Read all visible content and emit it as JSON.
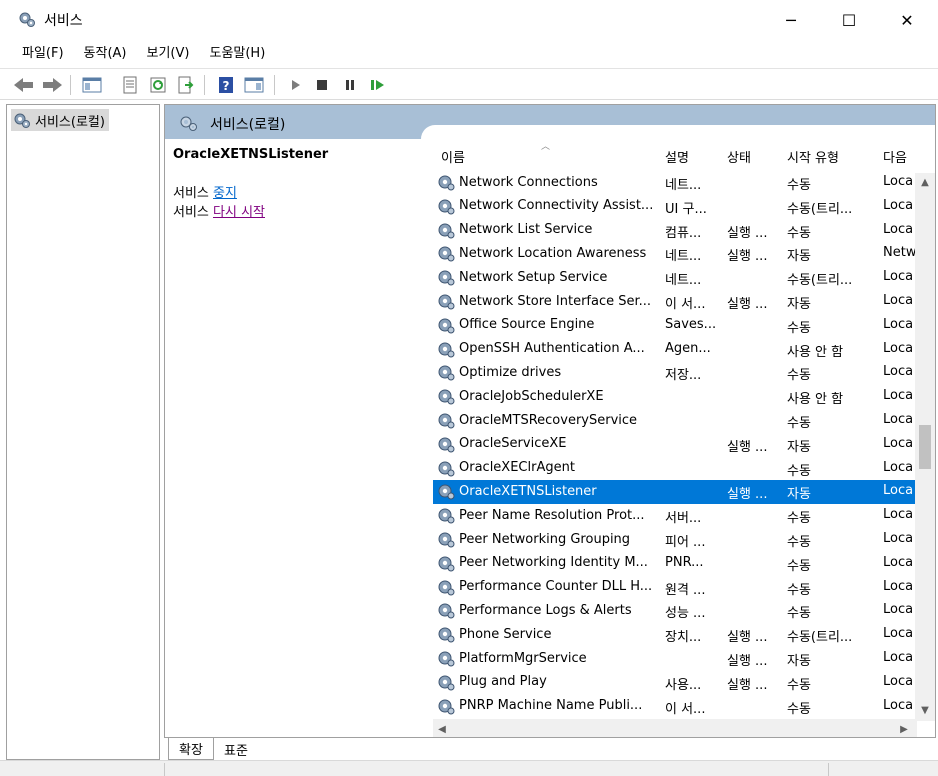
{
  "window": {
    "title": "서비스",
    "minimize_glyph": "─",
    "maximize_glyph": "☐",
    "close_glyph": "✕"
  },
  "menu": [
    "파일(F)",
    "동작(A)",
    "보기(V)",
    "도움말(H)"
  ],
  "toolbar_icons": [
    "back-arrow-icon",
    "forward-arrow-icon",
    "show-hide-console-tree-icon",
    "properties-icon",
    "refresh-icon",
    "export-list-icon",
    "help-icon",
    "show-action-pane-icon",
    "start-service-icon",
    "stop-service-icon",
    "pause-service-icon",
    "restart-service-icon"
  ],
  "tree": {
    "root_label": "서비스(로컬)"
  },
  "pane": {
    "header_title": "서비스(로컬)",
    "selected_service": "OracleXETNSListener",
    "action1_prefix": "서비스 ",
    "action1_link": "중지",
    "action2_prefix": "서비스 ",
    "action2_link": "다시 시작"
  },
  "columns": {
    "name": "이름",
    "desc": "설명",
    "status": "상태",
    "startup": "시작 유형",
    "logon": "다음"
  },
  "rows": [
    {
      "name": "Network Connections",
      "desc": "네트...",
      "status": "",
      "startup": "수동",
      "logon": "Loca"
    },
    {
      "name": "Network Connectivity Assist...",
      "desc": "UI 구...",
      "status": "",
      "startup": "수동(트리...",
      "logon": "Loca"
    },
    {
      "name": "Network List Service",
      "desc": "컴퓨...",
      "status": "실행 ...",
      "startup": "수동",
      "logon": "Loca"
    },
    {
      "name": "Network Location Awareness",
      "desc": "네트...",
      "status": "실행 ...",
      "startup": "자동",
      "logon": "Netw"
    },
    {
      "name": "Network Setup Service",
      "desc": "네트...",
      "status": "",
      "startup": "수동(트리...",
      "logon": "Loca"
    },
    {
      "name": "Network Store Interface Ser...",
      "desc": "이 서...",
      "status": "실행 ...",
      "startup": "자동",
      "logon": "Loca"
    },
    {
      "name": "Office  Source Engine",
      "desc": "Saves...",
      "status": "",
      "startup": "수동",
      "logon": "Loca"
    },
    {
      "name": "OpenSSH Authentication A...",
      "desc": "Agen...",
      "status": "",
      "startup": "사용 안 함",
      "logon": "Loca"
    },
    {
      "name": "Optimize drives",
      "desc": "저장...",
      "status": "",
      "startup": "수동",
      "logon": "Loca"
    },
    {
      "name": "OracleJobSchedulerXE",
      "desc": "",
      "status": "",
      "startup": "사용 안 함",
      "logon": "Loca"
    },
    {
      "name": "OracleMTSRecoveryService",
      "desc": "",
      "status": "",
      "startup": "수동",
      "logon": "Loca"
    },
    {
      "name": "OracleServiceXE",
      "desc": "",
      "status": "실행 ...",
      "startup": "자동",
      "logon": "Loca"
    },
    {
      "name": "OracleXEClrAgent",
      "desc": "",
      "status": "",
      "startup": "수동",
      "logon": "Loca"
    },
    {
      "name": "OracleXETNSListener",
      "desc": "",
      "status": "실행 ...",
      "startup": "자동",
      "logon": "Loca",
      "selected": true
    },
    {
      "name": "Peer Name Resolution Prot...",
      "desc": "서버...",
      "status": "",
      "startup": "수동",
      "logon": "Loca"
    },
    {
      "name": "Peer Networking Grouping",
      "desc": "피어 ...",
      "status": "",
      "startup": "수동",
      "logon": "Loca"
    },
    {
      "name": "Peer Networking Identity M...",
      "desc": "PNR...",
      "status": "",
      "startup": "수동",
      "logon": "Loca"
    },
    {
      "name": "Performance Counter DLL H...",
      "desc": "원격 ...",
      "status": "",
      "startup": "수동",
      "logon": "Loca"
    },
    {
      "name": "Performance Logs & Alerts",
      "desc": "성능 ...",
      "status": "",
      "startup": "수동",
      "logon": "Loca"
    },
    {
      "name": "Phone Service",
      "desc": "장치...",
      "status": "실행 ...",
      "startup": "수동(트리...",
      "logon": "Loca"
    },
    {
      "name": "PlatformMgrService",
      "desc": "",
      "status": "실행 ...",
      "startup": "자동",
      "logon": "Loca"
    },
    {
      "name": "Plug and Play",
      "desc": "사용...",
      "status": "실행 ...",
      "startup": "수동",
      "logon": "Loca"
    },
    {
      "name": "PNRP Machine Name Publi...",
      "desc": "이 서...",
      "status": "",
      "startup": "수동",
      "logon": "Loca"
    }
  ],
  "tabs": {
    "extended": "확장",
    "standard": "표준"
  },
  "colors": {
    "selection": "#0078d7",
    "pane_header": "#a8bfd6",
    "link": "#0066cc",
    "visited_link": "#800080"
  }
}
